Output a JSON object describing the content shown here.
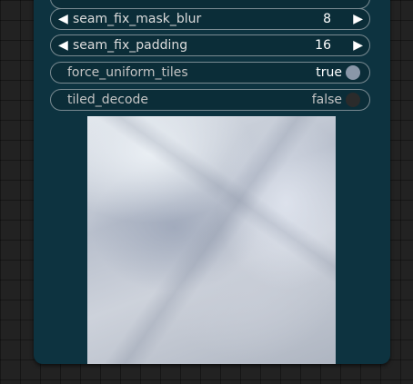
{
  "widgets": [
    {
      "label": "seam_fix_mask_blur",
      "value": "8"
    },
    {
      "label": "seam_fix_padding",
      "value": "16"
    }
  ],
  "toggles": [
    {
      "label": "force_uniform_tiles",
      "value": "true"
    },
    {
      "label": "tiled_decode",
      "value": "false"
    }
  ],
  "arrows": {
    "left": "◀",
    "right": "▶"
  }
}
